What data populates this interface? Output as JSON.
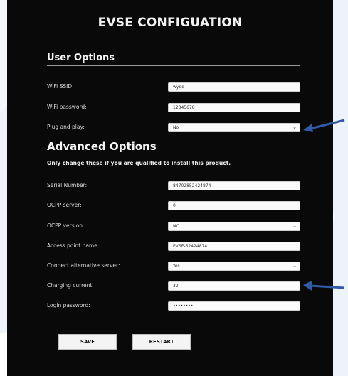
{
  "page": {
    "title": "EVSE CONFIGUATION"
  },
  "user_options": {
    "heading": "User Options",
    "wifi_ssid": {
      "label": "WiFi SSID:",
      "value": "wydq"
    },
    "wifi_password": {
      "label": "WiFi password:",
      "value": "12345678"
    },
    "plug_and_play": {
      "label": "Plug and play:",
      "value": "No"
    }
  },
  "advanced_options": {
    "heading": "Advanced Options",
    "note": "Only change these if you are qualified to install this product.",
    "serial_number": {
      "label": "Serial Number:",
      "value": "84702852424874"
    },
    "ocpp_server": {
      "label": "OCPP server:",
      "value": "0"
    },
    "ocpp_version": {
      "label": "OCPP version:",
      "value": "NO"
    },
    "access_point_name": {
      "label": "Access point name:",
      "value": "EVSE-52424874"
    },
    "connect_alternative_server": {
      "label": "Connect alternative server:",
      "value": "Yes"
    },
    "charging_current": {
      "label": "Charging current:",
      "value": "32"
    },
    "login_password": {
      "label": "Login password:",
      "value": "••••••••"
    }
  },
  "buttons": {
    "save": "SAVE",
    "restart": "RESTART"
  },
  "colors": {
    "panel_background": "#090909",
    "accent_arrow": "#2f5aa8",
    "side_shade": "#e8eef8"
  },
  "icons": {
    "select_chevron": "chevron-down-icon",
    "annotation_arrow": "arrow-left-icon"
  }
}
